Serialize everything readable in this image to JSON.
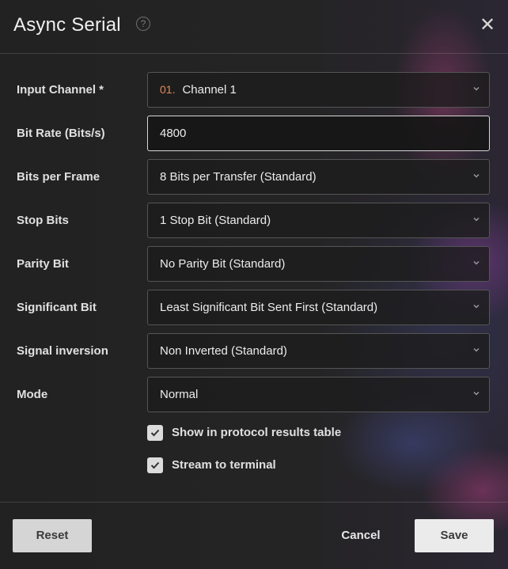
{
  "dialog": {
    "title": "Async Serial",
    "help_icon": "help-circle-icon",
    "close_icon": "close-icon"
  },
  "fields": {
    "input_channel": {
      "label": "Input Channel *",
      "prefix": "01.",
      "value": "Channel 1"
    },
    "bit_rate": {
      "label": "Bit Rate (Bits/s)",
      "value": "4800"
    },
    "bits_per_frame": {
      "label": "Bits per Frame",
      "value": "8 Bits per Transfer (Standard)"
    },
    "stop_bits": {
      "label": "Stop Bits",
      "value": "1 Stop Bit (Standard)"
    },
    "parity_bit": {
      "label": "Parity Bit",
      "value": "No Parity Bit (Standard)"
    },
    "significant_bit": {
      "label": "Significant Bit",
      "value": "Least Significant Bit Sent First (Standard)"
    },
    "signal_inversion": {
      "label": "Signal inversion",
      "value": "Non Inverted (Standard)"
    },
    "mode": {
      "label": "Mode",
      "value": "Normal"
    }
  },
  "checkboxes": {
    "show_in_table": {
      "label": "Show in protocol results table",
      "checked": true
    },
    "stream_to_terminal": {
      "label": "Stream to terminal",
      "checked": true
    }
  },
  "footer": {
    "reset_label": "Reset",
    "cancel_label": "Cancel",
    "save_label": "Save"
  }
}
